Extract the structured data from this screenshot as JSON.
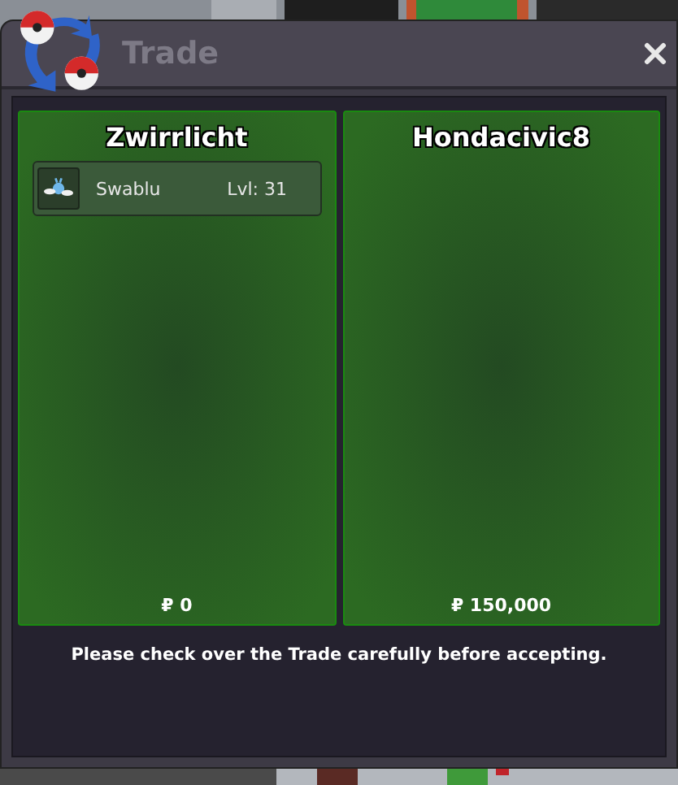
{
  "window": {
    "title": "Trade"
  },
  "traders": [
    {
      "name": "Zwirrlicht",
      "pokemon": [
        {
          "name": "Swablu",
          "level": "Lvl: 31"
        }
      ],
      "money": "₽ 0"
    },
    {
      "name": "Hondacivic8",
      "money": "₽ 150,000"
    }
  ],
  "message": "Please check over the Trade carefully before accepting."
}
